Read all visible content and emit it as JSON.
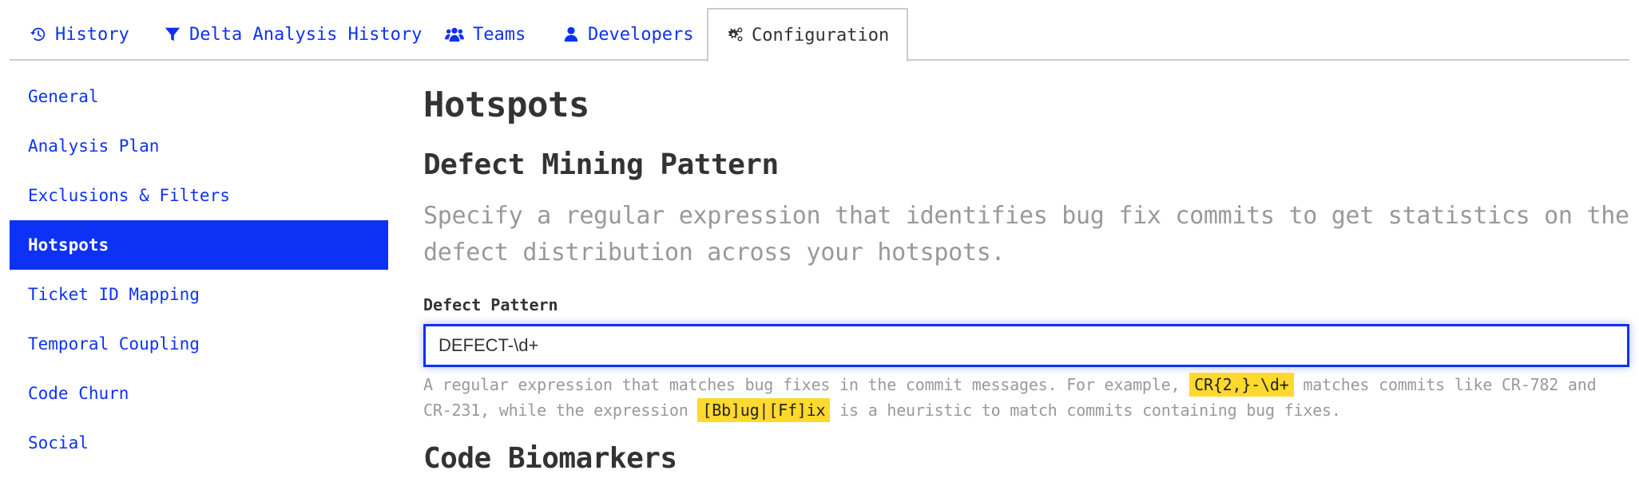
{
  "tabs": [
    {
      "label": "History",
      "icon": "history-icon",
      "active": false
    },
    {
      "label": "Delta Analysis History",
      "icon": "filter-icon",
      "active": false
    },
    {
      "label": "Teams",
      "icon": "users-icon",
      "active": false
    },
    {
      "label": "Developers",
      "icon": "user-icon",
      "active": false
    },
    {
      "label": "Configuration",
      "icon": "cogs-icon",
      "active": true
    }
  ],
  "sidebar": {
    "items": [
      {
        "label": "General",
        "active": false
      },
      {
        "label": "Analysis Plan",
        "active": false
      },
      {
        "label": "Exclusions & Filters",
        "active": false
      },
      {
        "label": "Hotspots",
        "active": true
      },
      {
        "label": "Ticket ID Mapping",
        "active": false
      },
      {
        "label": "Temporal Coupling",
        "active": false
      },
      {
        "label": "Code Churn",
        "active": false
      },
      {
        "label": "Social",
        "active": false
      }
    ]
  },
  "main": {
    "title": "Hotspots",
    "section": {
      "title": "Defect Mining Pattern",
      "description": "Specify a regular expression that identifies bug fix commits to get statistics on the defect distribution across your hotspots.",
      "field": {
        "label": "Defect Pattern",
        "value": "DEFECT-\\d+"
      },
      "help": {
        "part1": "A regular expression that matches bug fixes in the commit messages. For example, ",
        "code1": "CR{2,}-\\d+",
        "part2": " matches commits like CR-782 and CR-231, while the expression ",
        "code2": "[Bb]ug|[Ff]ix",
        "part3": " is a heuristic to match commits containing bug fixes."
      }
    },
    "next_section_title": "Code Biomarkers"
  },
  "colors": {
    "accent": "#0d32f5",
    "highlight": "#ffd92e",
    "muted_text": "#999999",
    "text": "#333333",
    "border": "#cccccc"
  }
}
